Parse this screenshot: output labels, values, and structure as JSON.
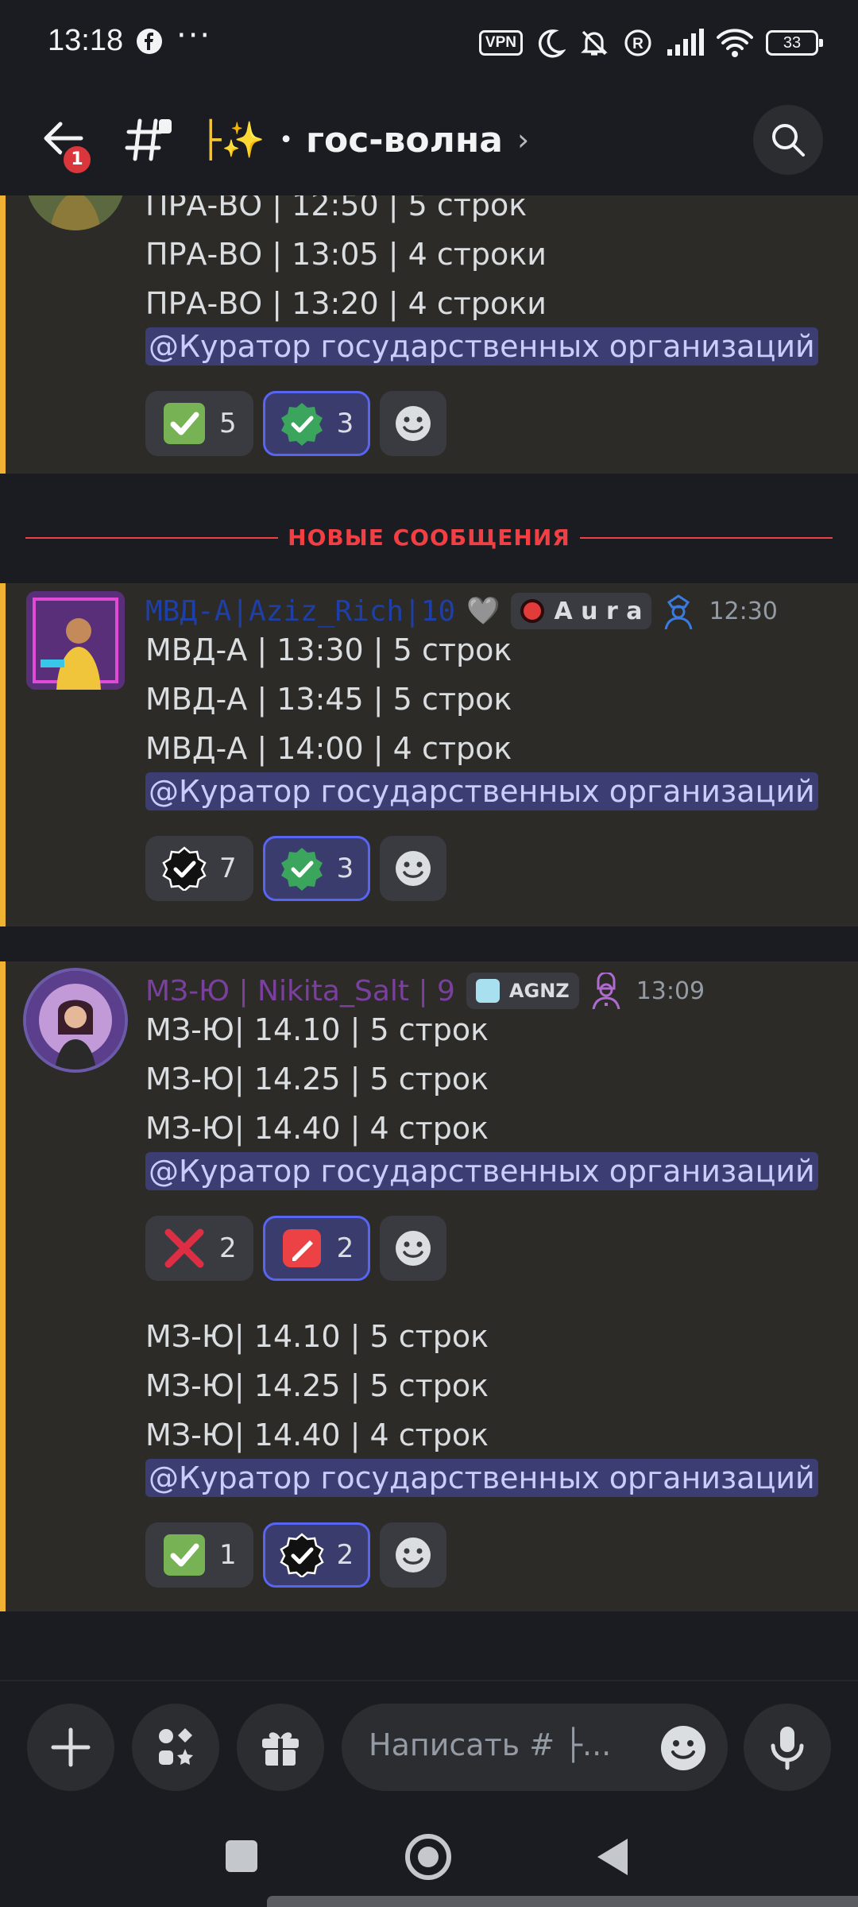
{
  "status_bar": {
    "time": "13:18",
    "dots": "···",
    "vpn_label": "VPN",
    "battery": "33",
    "icons": [
      "facebook-icon",
      "moon-icon",
      "bell-off-icon",
      "registered-icon",
      "signal-icon",
      "wifi-icon",
      "battery-icon"
    ]
  },
  "header": {
    "notification_count": "1",
    "title_prefix": "├✨",
    "title_dot": "•",
    "channel_name": "гос-волна",
    "chevron": "›"
  },
  "messages": {
    "first": {
      "lines": [
        "ПРА-ВО | 12:50 | 5 строк",
        "ПРА-ВО | 13:05 | 4 строки",
        "ПРА-ВО | 13:20 | 4 строки"
      ],
      "mention": "@Куратор государственных организаций",
      "reactions": [
        {
          "emoji": "green-check-box",
          "count": "5"
        },
        {
          "emoji": "green-verified-badge",
          "count": "3"
        }
      ]
    },
    "new_divider": "НОВЫЕ СООБЩЕНИЯ",
    "second": {
      "author": "МВД-А|Aziz_Rich|10",
      "author_color": "#1f3fa8",
      "heart": "🩶",
      "tag": "A u r a",
      "time": "12:30",
      "lines": [
        "МВД-А | 13:30 | 5 строк",
        "МВД-А | 13:45 | 5 строк",
        "МВД-А | 14:00 | 4 строк"
      ],
      "mention": "@Куратор государственных организаций",
      "reactions": [
        {
          "emoji": "black-verified-badge",
          "count": "7"
        },
        {
          "emoji": "green-verified-badge",
          "count": "3"
        }
      ]
    },
    "third": {
      "author": "МЗ-Ю | Nikita_Salt | 9",
      "author_color": "#7b3fa0",
      "tag": "AGNZ",
      "time": "13:09",
      "lines": [
        "МЗ-Ю| 14.10 | 5 строк",
        "МЗ-Ю|  14.25 | 5 строк",
        "МЗ-Ю| 14.40 | 4 строк"
      ],
      "mention": "@Куратор государственных организаций",
      "reactions": [
        {
          "emoji": "red-cross",
          "count": "2"
        },
        {
          "emoji": "red-pencil-app",
          "count": "2"
        }
      ],
      "followup": {
        "lines": [
          "МЗ-Ю| 14.10 | 5 строк",
          "МЗ-Ю|  14.25 | 5 строк",
          "МЗ-Ю| 14.40 | 4 строк"
        ],
        "mention": "@Куратор государственных организаций",
        "reactions": [
          {
            "emoji": "green-check-box",
            "count": "1"
          },
          {
            "emoji": "black-verified-badge",
            "count": "2"
          }
        ]
      }
    }
  },
  "composer": {
    "placeholder": "Написать # ├..."
  },
  "colors": {
    "accent": "#5865f2",
    "new_messages": "#f23f43",
    "highlight_bar": "#f0b232"
  }
}
